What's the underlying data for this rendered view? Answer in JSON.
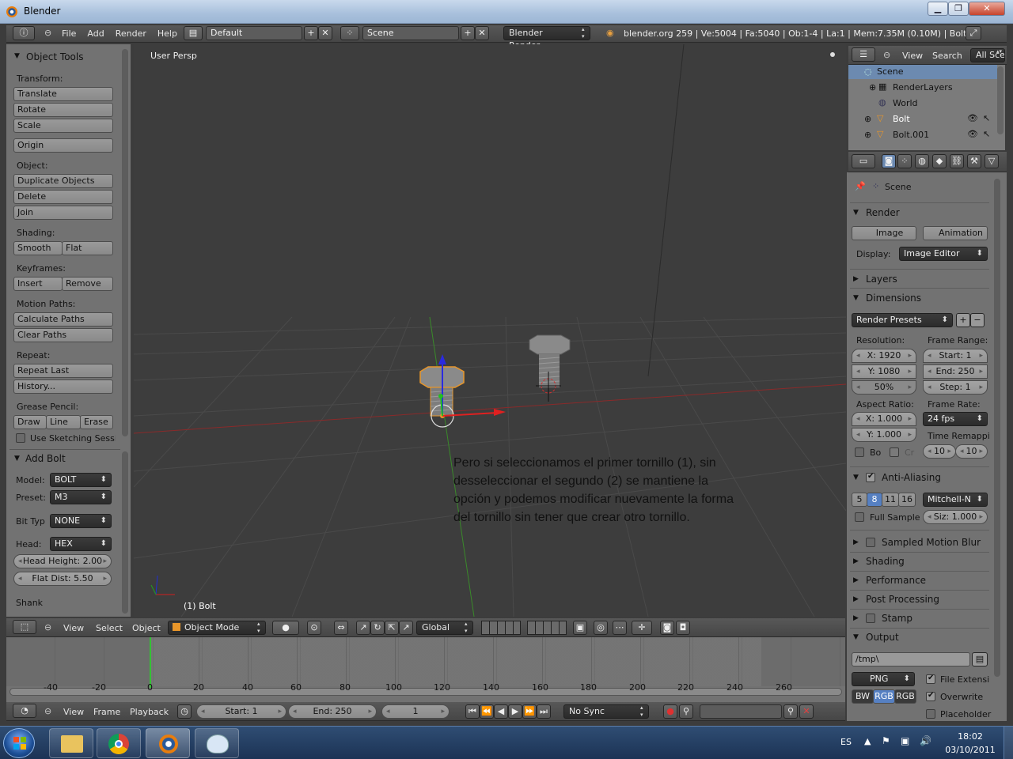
{
  "window": {
    "title": "Blender",
    "min": "▁",
    "max": "❐",
    "close": "✕"
  },
  "header": {
    "menus": [
      "File",
      "Add",
      "Render",
      "Help"
    ],
    "layout": "Default",
    "scene": "Scene",
    "engine": "Blender Render",
    "stats": "blender.org 259 | Ve:5004 | Fa:5040 | Ob:1-4 | La:1 | Mem:7.35M (0.10M) | Bolt"
  },
  "tools": {
    "title": "Object Tools",
    "transform": "Transform:",
    "translate": "Translate",
    "rotate": "Rotate",
    "scale": "Scale",
    "origin": "Origin",
    "object": "Object:",
    "duplicate": "Duplicate Objects",
    "delete": "Delete",
    "join": "Join",
    "shading": "Shading:",
    "smooth": "Smooth",
    "flat": "Flat",
    "keyframes": "Keyframes:",
    "insert": "Insert",
    "remove": "Remove",
    "motion": "Motion Paths:",
    "calc": "Calculate Paths",
    "clear": "Clear Paths",
    "repeat": "Repeat:",
    "repeat_last": "Repeat Last",
    "history": "History...",
    "grease": "Grease Pencil:",
    "draw": "Draw",
    "line": "Line",
    "erase": "Erase",
    "sketch": "Use Sketching Sessio"
  },
  "addbolt": {
    "title": "Add Bolt",
    "model_l": "Model:",
    "model": "BOLT",
    "preset_l": "Preset:",
    "preset": "M3",
    "bittype_l": "Bit Typ",
    "bittype": "NONE",
    "head_l": "Head:",
    "head": "HEX",
    "head_height": "Head Height: 2.00",
    "flat_dist": "Flat Dist: 5.50",
    "shank": "Shank"
  },
  "viewport": {
    "view_label": "User Persp",
    "object_label": "(1) Bolt",
    "annotation": "Pero si seleccionamos el primer tornillo (1), sin desseleccionar el  segundo (2) se mantiene la opción y podemos modificar nuevamente la forma del tornillo sin tener que crear otro tornillo."
  },
  "view3d_header": {
    "view": "View",
    "select": "Select",
    "object": "Object",
    "mode": "Object Mode",
    "orientation": "Global"
  },
  "outliner": {
    "view": "View",
    "search": "Search",
    "filter": "All Scen",
    "scene": "Scene",
    "renderlayers": "RenderLayers",
    "world": "World",
    "bolt": "Bolt",
    "bolt001": "Bolt.001"
  },
  "props": {
    "scene": "Scene",
    "render": "Render",
    "image": "Image",
    "animation": "Animation",
    "display_l": "Display:",
    "display": "Image Editor",
    "layers": "Layers",
    "dimensions": "Dimensions",
    "presets": "Render Presets",
    "resolution": "Resolution:",
    "frame_range": "Frame Range:",
    "resx": "X: 1920",
    "resy": "Y: 1080",
    "pct": "50%",
    "start": "Start: 1",
    "end": "End: 250",
    "step": "Step: 1",
    "aspect": "Aspect Ratio:",
    "frame_rate": "Frame Rate:",
    "ax": "X: 1.000",
    "ay": "Y: 1.000",
    "fps": "24 fps",
    "remap": "Time Remappi",
    "bo": "Bo",
    "cr": "Cr",
    "r1": "10",
    "r2": "10",
    "aa": "Anti-Aliasing",
    "s5": "5",
    "s8": "8",
    "s11": "11",
    "s16": "16",
    "filter": "Mitchell-N",
    "full": "Full Sample",
    "siz": "Siz: 1.000",
    "smb": "Sampled Motion Blur",
    "shading": "Shading",
    "performance": "Performance",
    "post": "Post Processing",
    "stamp": "Stamp",
    "output": "Output",
    "path": "/tmp\\",
    "format": "PNG",
    "fileext": "File Extensi",
    "bw": "BW",
    "rgb": "RGB",
    "rgba": "RGB",
    "overwrite": "Overwrite",
    "placeholder": "Placeholder"
  },
  "timeline": {
    "ticks": [
      "-40",
      "-20",
      "0",
      "20",
      "40",
      "60",
      "80",
      "100",
      "120",
      "140",
      "160",
      "180",
      "200",
      "220",
      "240",
      "260"
    ],
    "view": "View",
    "frame": "Frame",
    "playback": "Playback",
    "start": "Start: 1",
    "end": "End: 250",
    "current": "1",
    "sync": "No Sync"
  },
  "taskbar": {
    "lang": "ES",
    "time": "18:02",
    "date": "03/10/2011"
  }
}
